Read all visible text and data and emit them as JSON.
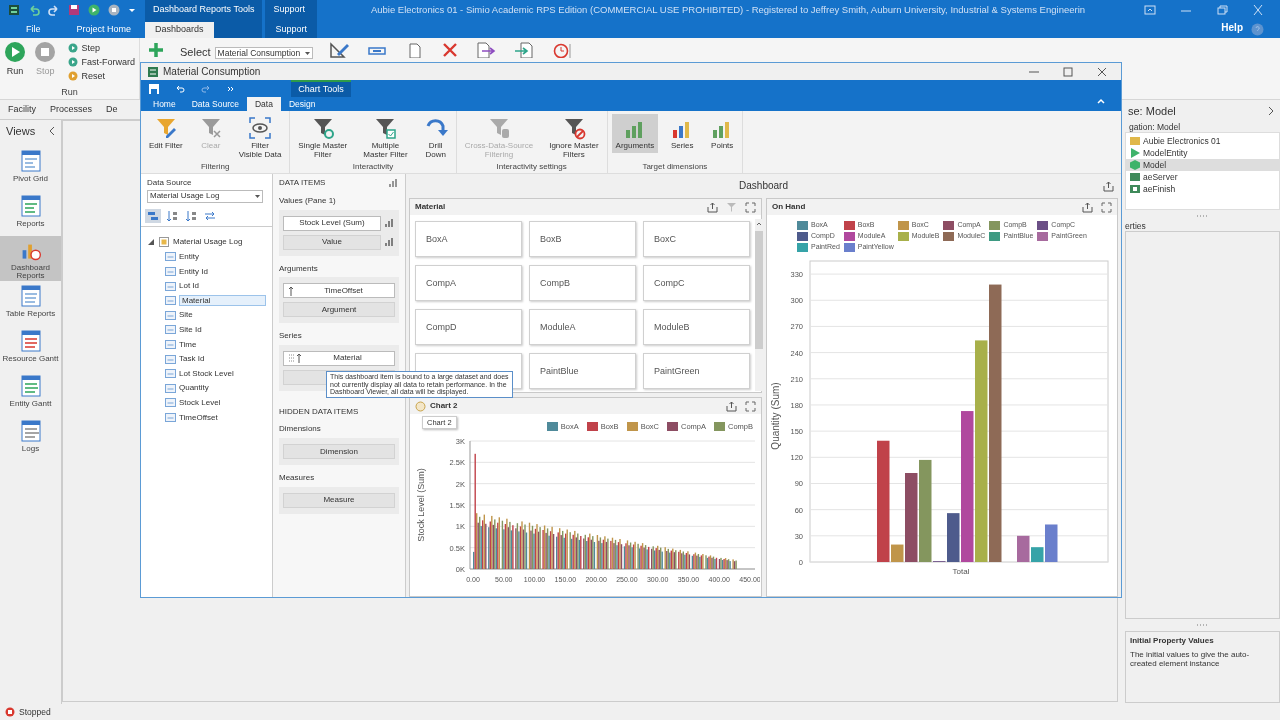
{
  "app": {
    "title": "Aubie Electronics 01 - Simio Academic RPS Edition (COMMERCIAL USE PROHIBITED) - Registered to Jeffrey Smith, Auburn University, Industrial & Systems Engineerin",
    "tabs": [
      {
        "label": "File",
        "selected": false
      },
      {
        "label": "Project Home",
        "selected": false
      }
    ],
    "context_groups": [
      {
        "title": "Dashboard Reports Tools",
        "tabs": [
          {
            "label": "Dashboards",
            "selected": true
          }
        ]
      },
      {
        "title": "Support",
        "tabs": [
          {
            "label": "Support",
            "selected": false
          }
        ]
      }
    ],
    "help": "Help",
    "run_group": {
      "label": "Run",
      "buttons": [
        {
          "label": "Run",
          "disabled": false
        },
        {
          "label": "Stop",
          "disabled": true
        }
      ],
      "small_buttons": [
        {
          "label": "Step"
        },
        {
          "label": "Fast-Forward"
        },
        {
          "label": "Reset"
        }
      ]
    },
    "select": {
      "label": "Select",
      "value": "Material Consumption"
    },
    "view_tabs": [
      {
        "label": "Facility"
      },
      {
        "label": "Processes"
      },
      {
        "label": "De"
      }
    ],
    "views": {
      "title": "Views",
      "items": [
        {
          "label": "Pivot Grid",
          "selected": false
        },
        {
          "label": "Reports",
          "selected": false
        },
        {
          "label": "Dashboard Reports",
          "selected": true
        },
        {
          "label": "Table Reports",
          "selected": false
        },
        {
          "label": "Resource Gantt",
          "selected": false
        },
        {
          "label": "Entity Gantt",
          "selected": false
        },
        {
          "label": "Logs",
          "selected": false
        }
      ]
    },
    "browse": {
      "title": "se: Model",
      "navigation_label": "gation: Model",
      "tree": [
        {
          "label": "Aubie Electronics 01",
          "selected": false
        },
        {
          "label": "ModelEntity",
          "selected": false
        },
        {
          "label": "Model",
          "selected": true
        },
        {
          "label": "aeServer",
          "selected": false
        },
        {
          "label": "aeFinish",
          "selected": false
        }
      ],
      "properties_label": "erties"
    },
    "help_box": {
      "title": "Initial Property Values",
      "text": "The initial values to give the auto-created element instance"
    },
    "status": "Stopped"
  },
  "dialog": {
    "title": "Material Consumption",
    "context_group": "Chart Tools",
    "tabs": [
      {
        "label": "Home",
        "selected": false
      },
      {
        "label": "Data Source",
        "selected": false
      },
      {
        "label": "Data",
        "selected": true
      },
      {
        "label": "Design",
        "selected": false
      }
    ],
    "ribbon_groups": [
      {
        "label": "Filtering",
        "buttons": [
          {
            "label": "Edit Filter",
            "disabled": false,
            "selected": false
          },
          {
            "label": "Clear",
            "disabled": true,
            "selected": false
          },
          {
            "label": "Filter\nVisible Data",
            "disabled": false,
            "selected": false
          }
        ]
      },
      {
        "label": "Interactivity",
        "buttons": [
          {
            "label": "Single Master\nFilter",
            "disabled": false,
            "selected": false
          },
          {
            "label": "Multiple\nMaster Filter",
            "disabled": false,
            "selected": false
          },
          {
            "label": "Drill\nDown",
            "disabled": false,
            "selected": false
          }
        ]
      },
      {
        "label": "Interactivity settings",
        "buttons": [
          {
            "label": "Cross-Data-Source\nFiltering",
            "disabled": true,
            "selected": false
          },
          {
            "label": "Ignore Master\nFilters",
            "disabled": false,
            "selected": false
          }
        ]
      },
      {
        "label": "Target dimensions",
        "buttons": [
          {
            "label": "Arguments",
            "disabled": false,
            "selected": true
          },
          {
            "label": "Series",
            "disabled": false,
            "selected": false
          },
          {
            "label": "Points",
            "disabled": false,
            "selected": false
          }
        ]
      }
    ],
    "data_source": {
      "label": "Data Source",
      "value": "Material Usage Log",
      "tree": {
        "label": "Material Usage Log",
        "expanded": true,
        "children": [
          {
            "label": "Entity",
            "selected": false
          },
          {
            "label": "Entity Id",
            "selected": false
          },
          {
            "label": "Lot Id",
            "selected": false
          },
          {
            "label": "Material",
            "selected": true
          },
          {
            "label": "Site",
            "selected": false
          },
          {
            "label": "Site Id",
            "selected": false
          },
          {
            "label": "Time",
            "selected": false
          },
          {
            "label": "Task Id",
            "selected": false
          },
          {
            "label": "Lot Stock Level",
            "selected": false
          },
          {
            "label": "Quantity",
            "selected": false
          },
          {
            "label": "Stock Level",
            "selected": false
          },
          {
            "label": "TimeOffset",
            "selected": false
          }
        ]
      }
    },
    "data_items": {
      "title": "DATA ITEMS",
      "sections": [
        {
          "label": "Values (Pane 1)",
          "items": [
            {
              "kind": "field",
              "label": "Stock Level (Sum)"
            },
            {
              "kind": "placeholder",
              "label": "Value"
            }
          ]
        },
        {
          "label": "Arguments",
          "items": [
            {
              "kind": "field",
              "label": "TimeOffset"
            },
            {
              "kind": "placeholder",
              "label": "Argument"
            }
          ]
        },
        {
          "label": "Series",
          "items": [
            {
              "kind": "field",
              "label": "Material"
            },
            {
              "kind": "placeholder"
            }
          ]
        }
      ],
      "hidden_title": "HIDDEN DATA ITEMS",
      "hidden_sections": [
        {
          "label": "Dimensions",
          "items": [
            {
              "kind": "placeholder",
              "label": "Dimension"
            }
          ]
        },
        {
          "label": "Measures",
          "items": [
            {
              "kind": "placeholder",
              "label": "Measure"
            }
          ]
        }
      ]
    },
    "dashboard": {
      "title": "Dashboard",
      "material": {
        "title": "Material",
        "items": [
          {
            "label": "BoxA"
          },
          {
            "label": "BoxB"
          },
          {
            "label": "BoxC"
          },
          {
            "label": "CompA"
          },
          {
            "label": "CompB"
          },
          {
            "label": "CompC"
          },
          {
            "label": "CompD"
          },
          {
            "label": "ModuleA"
          },
          {
            "label": "ModuleB"
          },
          {
            "covered": true
          },
          {
            "label": "PaintBlue"
          },
          {
            "label": "PaintGreen"
          }
        ]
      },
      "chart2": {
        "title": "Chart 2",
        "tooltip": "Chart 2",
        "legend": [
          {
            "label": "BoxA",
            "color": "#4f8a9a"
          },
          {
            "label": "BoxB",
            "color": "#c0424a"
          },
          {
            "label": "BoxC",
            "color": "#c0954a"
          },
          {
            "label": "CompA",
            "color": "#8d4d63"
          },
          {
            "label": "CompB",
            "color": "#84965e"
          }
        ],
        "ylabel": "Stock Level (Sum)",
        "y_labels": [
          "3K",
          "2.5K",
          "2K",
          "1.5K",
          "1K",
          "0.5K",
          "0K"
        ],
        "x_labels": [
          "0.00",
          "50.00",
          "100.00",
          "150.00",
          "200.00",
          "250.00",
          "300.00",
          "350.00",
          "400.00",
          "450.00"
        ]
      },
      "on_hand": {
        "title": "On Hand",
        "chart_data": {
          "type": "bar",
          "grid": true,
          "ylabel": "Quantity (Sum)",
          "categories": [
            "Total"
          ],
          "ylim": [
            0,
            345
          ],
          "yticks": [
            0,
            30,
            60,
            90,
            120,
            150,
            180,
            210,
            240,
            270,
            300,
            330
          ],
          "series": [
            {
              "name": "BoxA",
              "color": "#4f8a9a",
              "values": [
                0
              ]
            },
            {
              "name": "BoxB",
              "color": "#c0424a",
              "values": [
                139
              ]
            },
            {
              "name": "BoxC",
              "color": "#c0954a",
              "values": [
                20
              ]
            },
            {
              "name": "CompA",
              "color": "#8d4d63",
              "values": [
                102
              ]
            },
            {
              "name": "CompB",
              "color": "#84965e",
              "values": [
                117
              ]
            },
            {
              "name": "CompC",
              "color": "#6b4f86",
              "values": [
                1
              ]
            },
            {
              "name": "CompD",
              "color": "#4e5b8c",
              "values": [
                56
              ]
            },
            {
              "name": "ModuleA",
              "color": "#b0489e",
              "values": [
                173
              ]
            },
            {
              "name": "ModuleB",
              "color": "#a8b04a",
              "values": [
                254
              ]
            },
            {
              "name": "ModuleC",
              "color": "#8e6a56",
              "values": [
                318
              ]
            },
            {
              "name": "PaintBlue",
              "color": "#3e9a82",
              "values": [
                0
              ]
            },
            {
              "name": "PaintGreen",
              "color": "#a76a9e",
              "values": [
                30
              ]
            },
            {
              "name": "PaintRed",
              "color": "#36a3a8",
              "values": [
                17
              ]
            },
            {
              "name": "PaintYellow",
              "color": "#6a7fcc",
              "values": [
                43
              ]
            }
          ]
        }
      }
    },
    "tooltip": "This dashboard item is bound to a large dataset and does not currently display all data to retain performance. In the Dashboard Viewer, all data will be displayed."
  }
}
